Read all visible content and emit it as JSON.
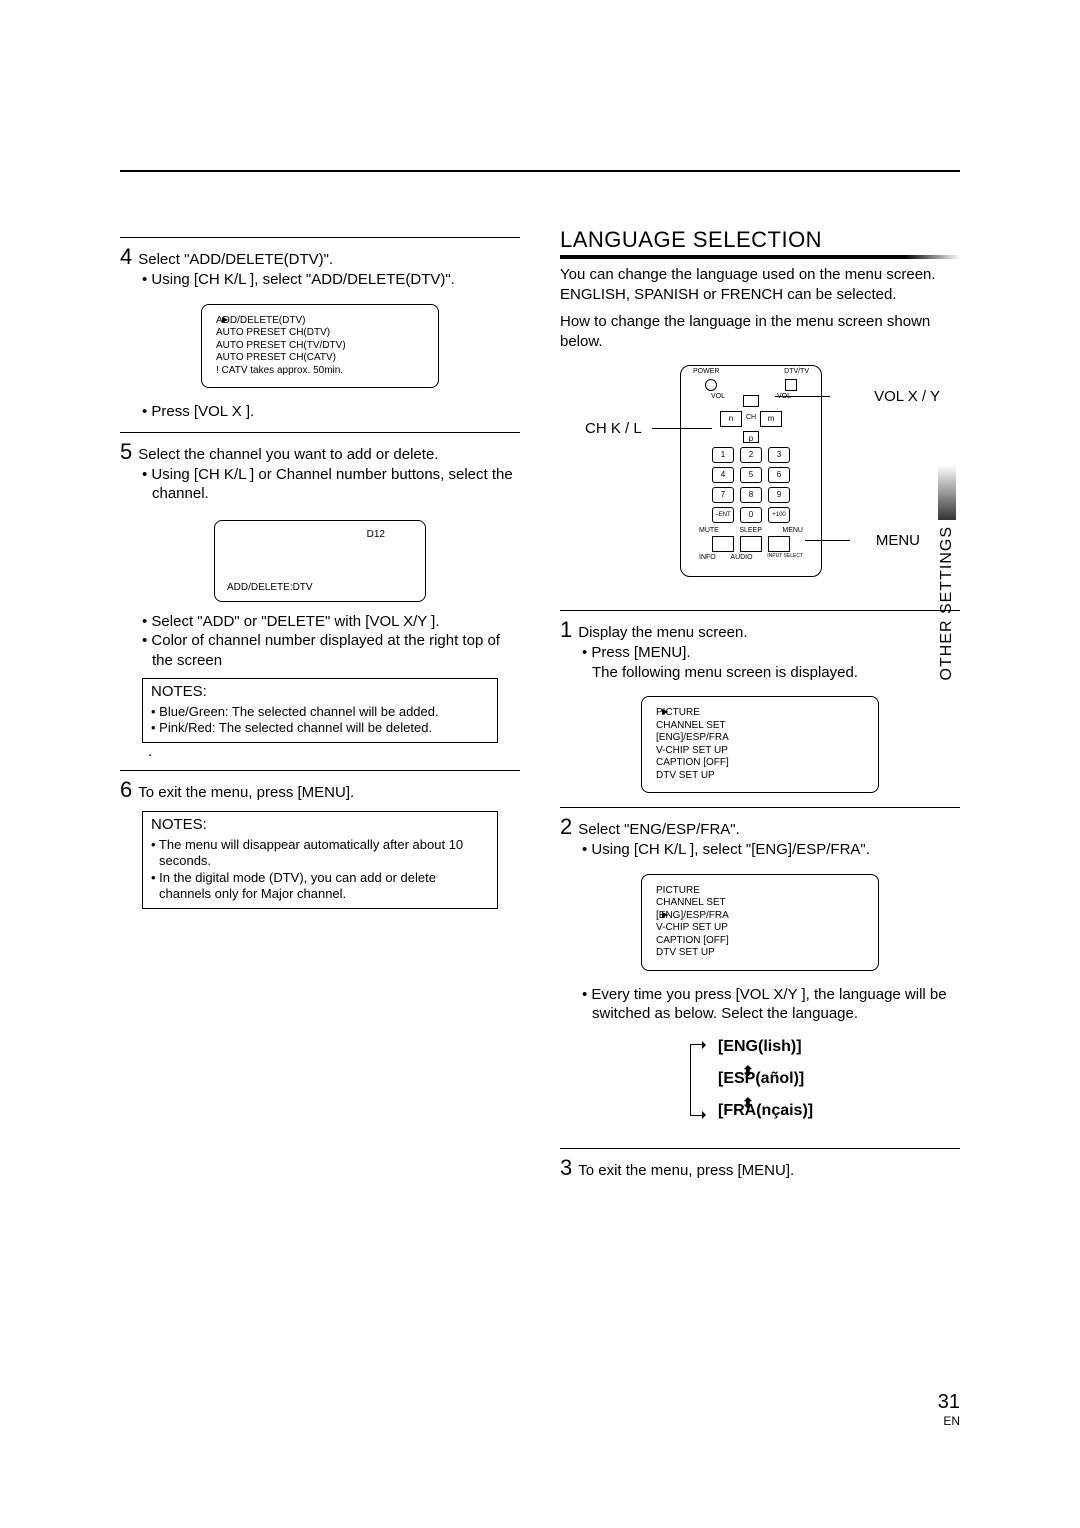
{
  "left": {
    "step4": {
      "num": "4",
      "title": "Select \"ADD/DELETE(DTV)\".",
      "bullet": "• Using [CH K/L ], select \"ADD/DELETE(DTV)\".",
      "screen": {
        "l1_sel": "ADD/DELETE(DTV)",
        "l2": "AUTO PRESET CH(DTV)",
        "l3": "AUTO PRESET CH(TV/DTV)",
        "l4": "AUTO PRESET CH(CATV)",
        "l5": "! CATV takes approx. 50min."
      },
      "after": "• Press [VOL X ]."
    },
    "step5": {
      "num": "5",
      "title": "Select the channel you want to add or delete.",
      "bullet": "• Using [CH K/L ] or Channel number buttons, select the channel.",
      "d12_top": "D12",
      "d12_bottom": "ADD/DELETE:DTV",
      "sub1": "• Select \"ADD\" or \"DELETE\" with [VOL X/Y ].",
      "sub2": "• Color of channel number displayed at the right top of the screen",
      "notes_head": "NOTES:",
      "note1": "• Blue/Green: The selected channel will be added.",
      "note2": "• Pink/Red: The selected channel will be deleted.",
      "dot": "."
    },
    "step6": {
      "num": "6",
      "title": "To exit the menu, press [MENU].",
      "notes_head": "NOTES:",
      "note1": "• The menu will disappear automatically after about 10 seconds.",
      "note2": "• In the digital mode (DTV), you can add or delete channels only for Major channel."
    }
  },
  "right": {
    "section": "LANGUAGE SELECTION",
    "intro1": "You can change the language used on the menu screen. ENGLISH, SPANISH or FRENCH can be selected.",
    "intro2": "How to change the language in the menu screen shown below.",
    "callouts": {
      "vol": "VOL X / Y",
      "ch": "CH K / L",
      "menu": "MENU"
    },
    "remote": {
      "top_l": "POWER",
      "top_r": "DTV/TV",
      "vol": "VOL",
      "ch": "CH",
      "n": "n",
      "m": "m",
      "p": "p",
      "k1": "1",
      "k2": "2",
      "k3": "3",
      "k4": "4",
      "k5": "5",
      "k6": "6",
      "k7": "7",
      "k8": "8",
      "k9": "9",
      "kent": "–ENT",
      "k0": "0",
      "k100": "+100",
      "mute": "MUTE",
      "sleep": "SLEEP",
      "menu": "MENU",
      "info": "INFO",
      "audio": "AUDIO",
      "insel": "INPUT SELECT"
    },
    "step1": {
      "num": "1",
      "title": "Display the menu screen.",
      "b1": "• Press [MENU].",
      "b2": "The following menu screen is displayed.",
      "screen": {
        "sel": "PICTURE",
        "l2": "CHANNEL SET",
        "l3": "[ENG]/ESP/FRA",
        "l4": "V-CHIP SET UP",
        "l5": "CAPTION [OFF]",
        "l6": "DTV SET UP"
      }
    },
    "step2": {
      "num": "2",
      "title": "Select \"ENG/ESP/FRA\".",
      "b1": "• Using [CH K/L ], select \"[ENG]/ESP/FRA\".",
      "screen": {
        "l1": "PICTURE",
        "l2": "CHANNEL SET",
        "sel": "[ENG]/ESP/FRA",
        "l4": "V-CHIP SET UP",
        "l5": "CAPTION [OFF]",
        "l6": "DTV SET UP"
      },
      "b2": "• Every time you press [VOL X/Y ], the language will be switched as below. Select the language.",
      "cycle": {
        "eng": "[ENG(lish)]",
        "esp": "[ESP(añol)]",
        "fra": "[FRA(nçais)]"
      }
    },
    "step3": {
      "num": "3",
      "title": "To exit the menu, press [MENU]."
    }
  },
  "side_tab": "OTHER SETTINGS",
  "footer": {
    "page": "31",
    "lang": "EN"
  }
}
